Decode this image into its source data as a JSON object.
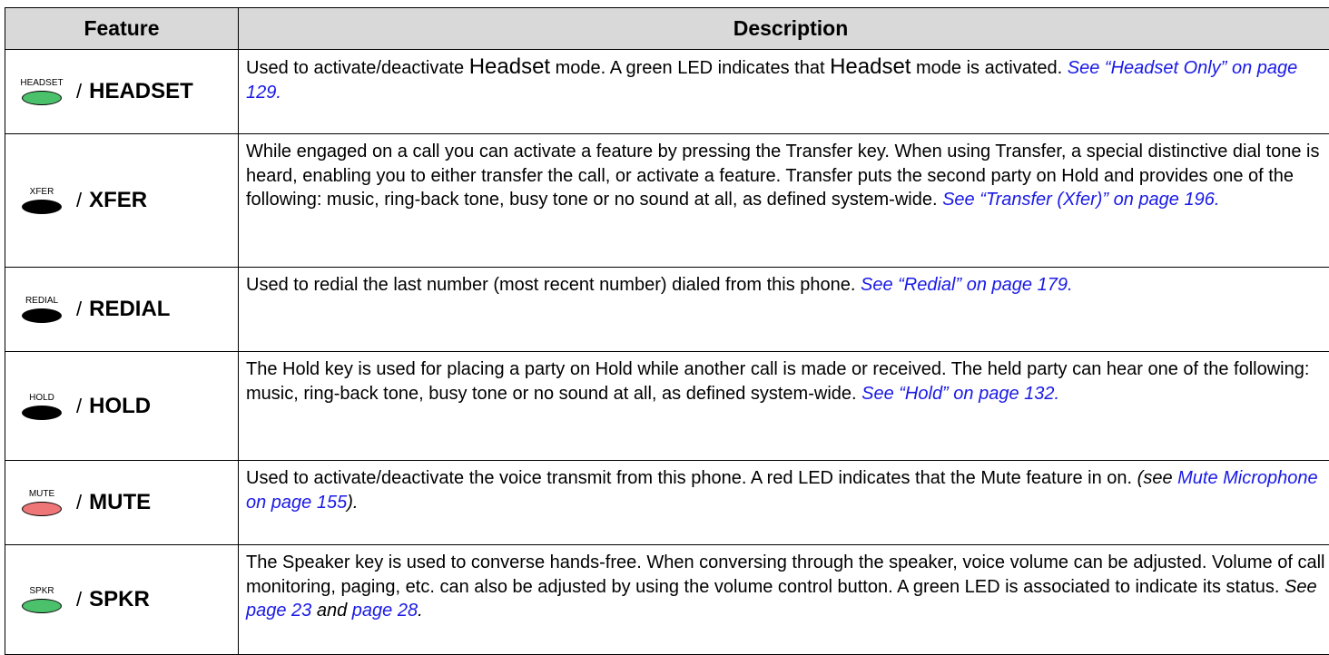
{
  "headers": {
    "feature": "Feature",
    "description": "Description"
  },
  "colors": {
    "link": "#1a1ae6",
    "header_bg": "#d9d9d9",
    "led_green": "#4cc16c",
    "led_red": "#ef7676",
    "key_black": "#000000"
  },
  "rows": [
    {
      "key_caption": "HEADSET",
      "key_color": "green",
      "name": "HEADSET",
      "t1": "Used to activate/deactivate ",
      "t2": "Headset",
      "t3": " mode. A green LED indicates that ",
      "t4": "Headset",
      "t5": " mode is activated. ",
      "link": "See “Headset Only” on page 129."
    },
    {
      "key_caption": "XFER",
      "key_color": "black",
      "name": "XFER",
      "t1": "While engaged on a call you can activate a feature by pressing the Transfer key. When using Transfer, a special distinctive dial tone is heard, enabling you to either transfer the call, or activate a feature. Transfer puts the second party on Hold and provides one of the following: music, ring-back tone, busy tone or no sound at all, as defined system-wide. ",
      "link": "See “Transfer (Xfer)” on page 196."
    },
    {
      "key_caption": "REDIAL",
      "key_color": "black",
      "name": "REDIAL",
      "t1": "Used to redial the last number (most recent number) dialed from this phone. ",
      "link": "See “Redial” on page 179."
    },
    {
      "key_caption": "HOLD",
      "key_color": "black",
      "name": "HOLD",
      "t1": "The Hold key is used for placing a party on Hold while another call is made or received. The held party can hear one of the following: music, ring-back tone, busy tone or no sound at all, as defined system-wide. ",
      "link": "See “Hold” on page 132."
    },
    {
      "key_caption": "MUTE",
      "key_color": "red",
      "name": "MUTE",
      "t1": "Used to activate/deactivate the voice transmit from this phone. A red LED indicates that the Mute feature in on. ",
      "i1": "(see ",
      "link": "Mute Microphone on page 155",
      "i2": ")."
    },
    {
      "key_caption": "SPKR",
      "key_color": "green",
      "name": "SPKR",
      "t1": "The Speaker key is used to converse hands-free. When conversing through the speaker, voice volume can be adjusted. Volume of call monitoring, paging, etc. can also be adjusted by using the volume control button. A green LED is associated to indicate its status. ",
      "i1": "See ",
      "link": "page 23",
      "i2": " and ",
      "link2": "page 28",
      "i3": "."
    }
  ]
}
